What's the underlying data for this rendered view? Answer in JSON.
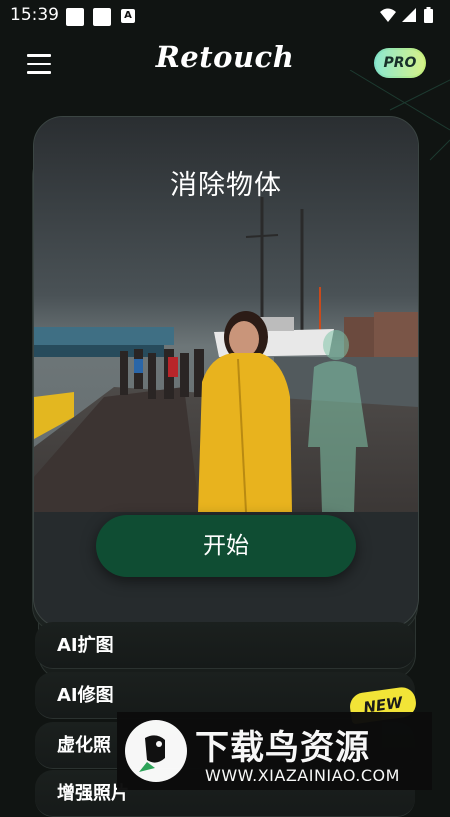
{
  "status_bar": {
    "time": "15:39",
    "notif_icons": [
      "square-icon",
      "square-icon",
      "a-icon"
    ],
    "notif_a_label": "A",
    "system_icons": [
      "wifi-icon",
      "signal-icon",
      "battery-icon"
    ]
  },
  "header": {
    "app_title": "Retouch",
    "pro_label": "PRO"
  },
  "main_card": {
    "title": "消除物体",
    "start_label": "开始"
  },
  "features": {
    "items": [
      {
        "label": "AI扩图"
      },
      {
        "label": "AI修图"
      },
      {
        "label": "虚化照"
      },
      {
        "label": "增强照片"
      }
    ],
    "new_badge": "NEW"
  },
  "watermark": {
    "title": "下载鸟资源",
    "url": "WWW.XIAZAINIAO.COM"
  },
  "colors": {
    "background": "#101412",
    "start_button": "#0f4d33",
    "pro_badge": "#b6ec8e",
    "new_badge": "#f2e437"
  }
}
